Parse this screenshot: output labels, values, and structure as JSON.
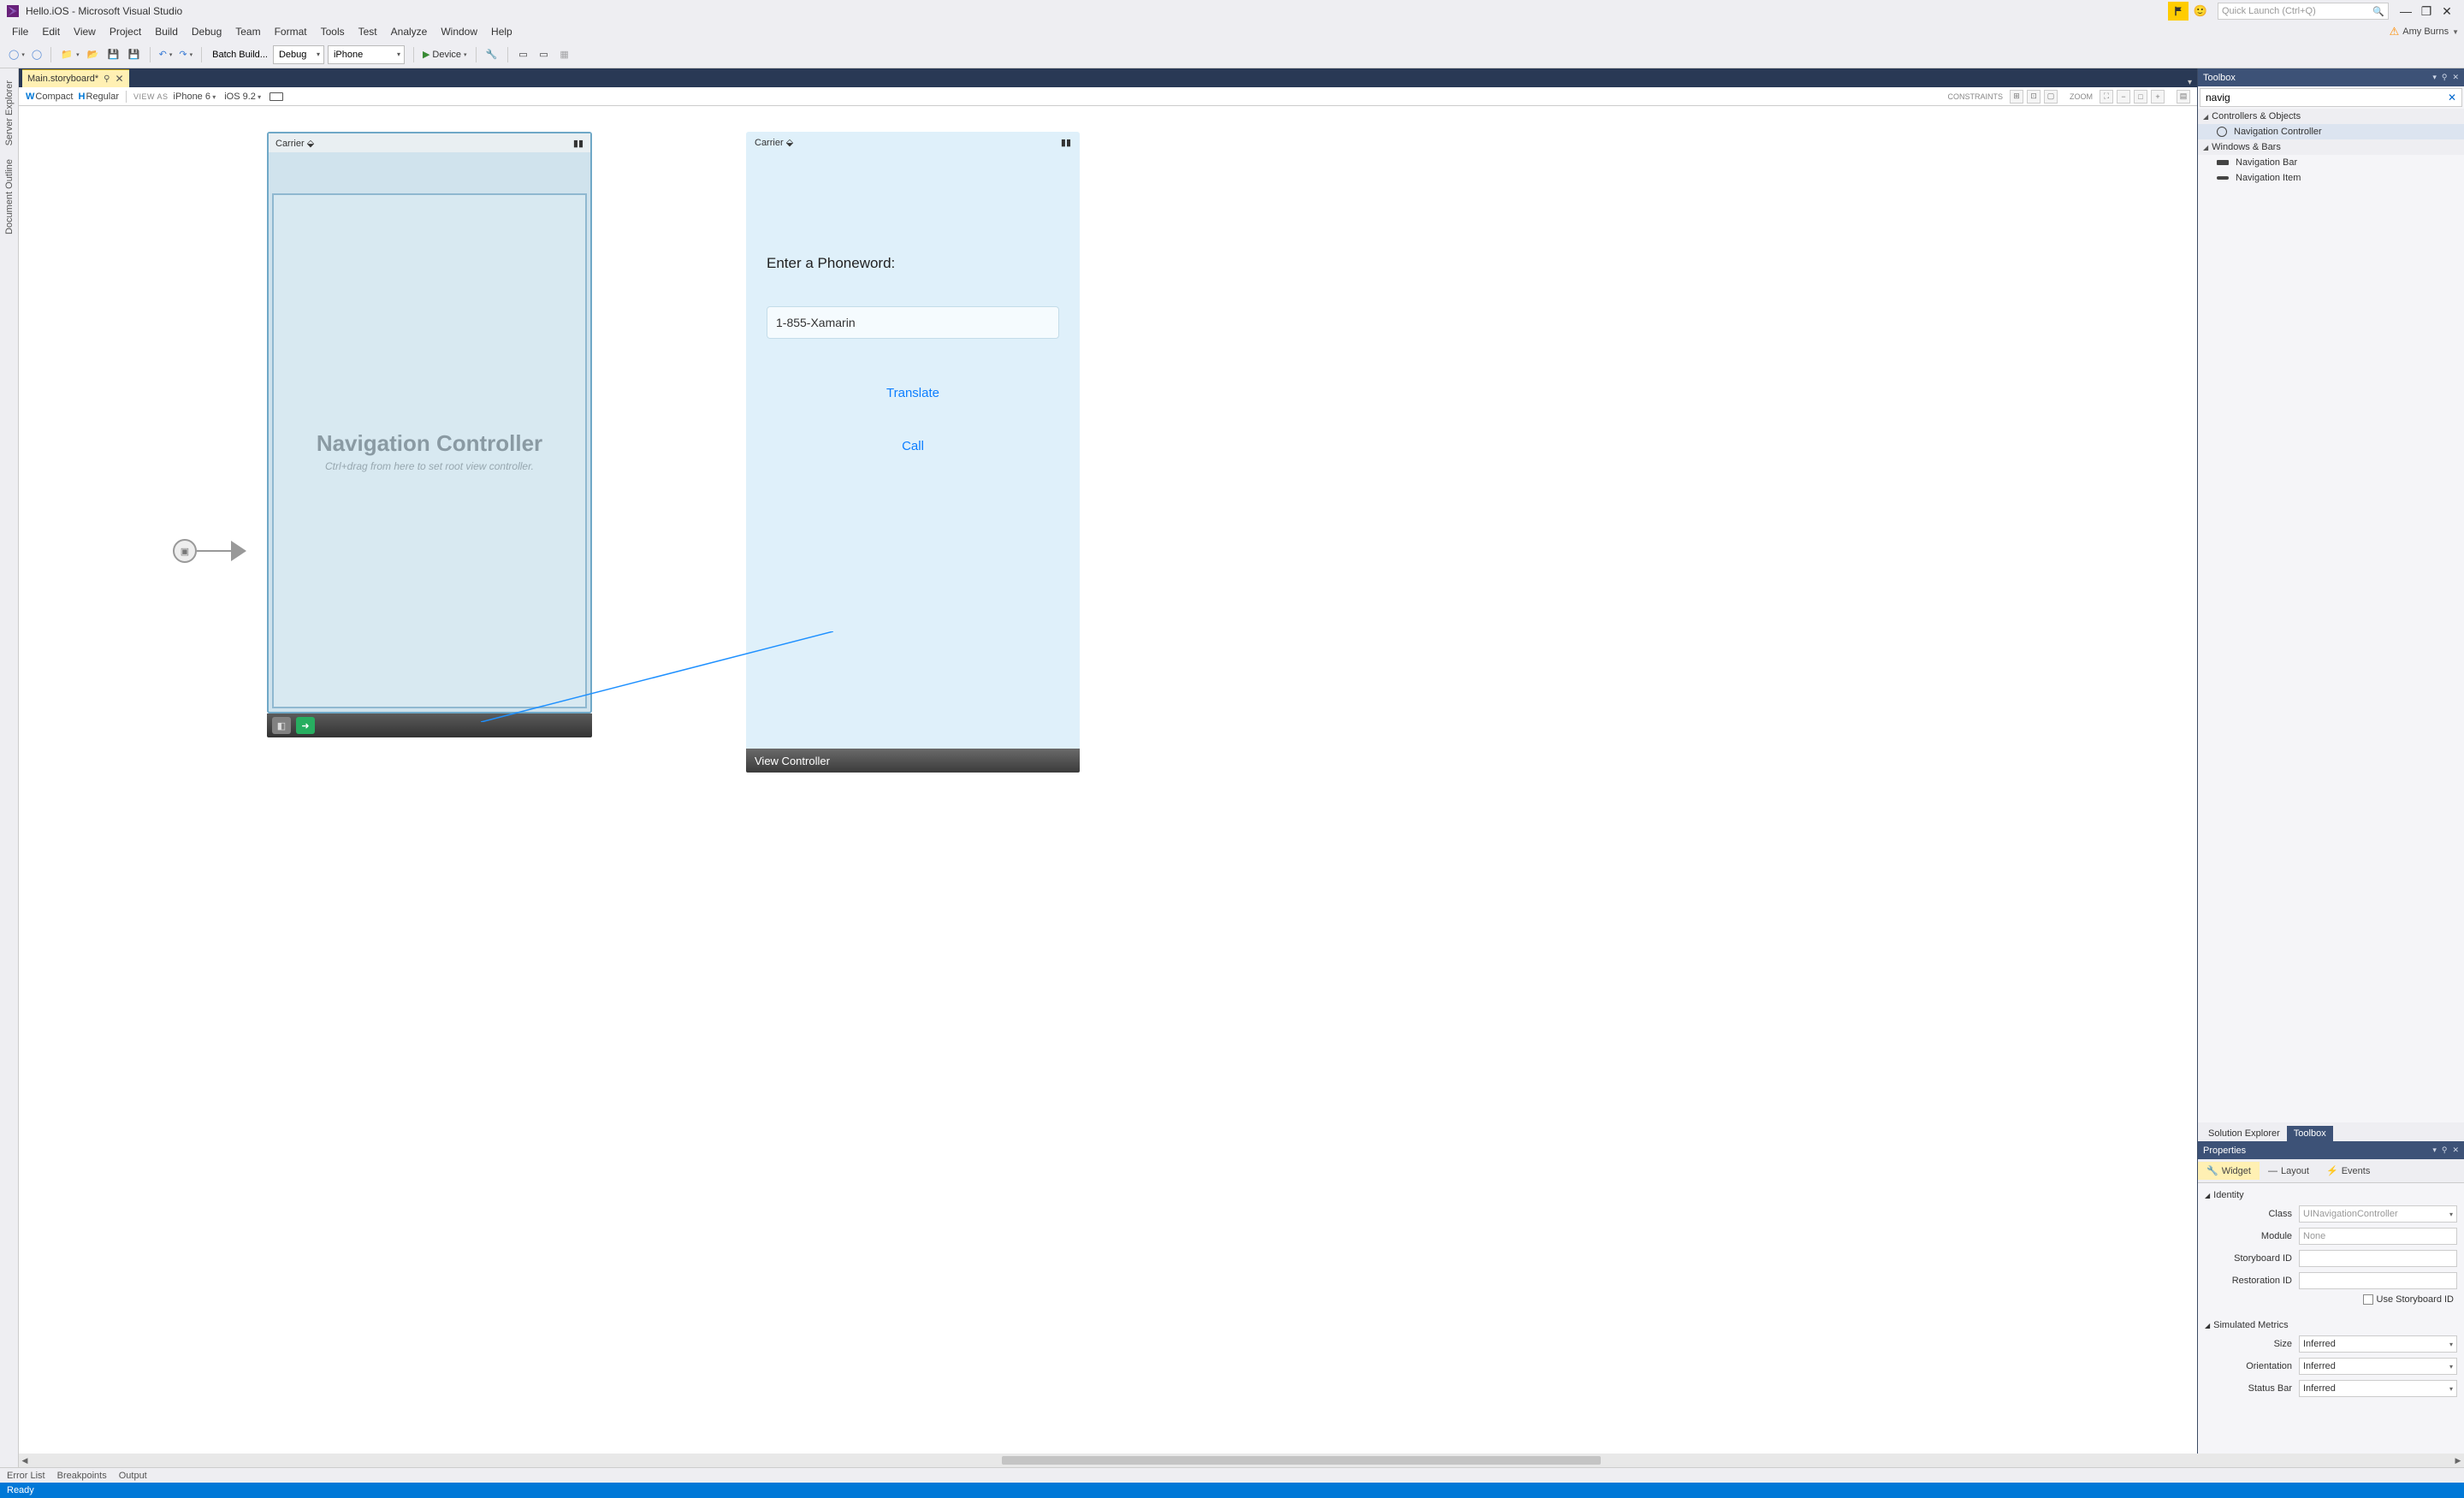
{
  "title": "Hello.iOS - Microsoft Visual Studio",
  "quickLaunch": {
    "placeholder": "Quick Launch (Ctrl+Q)"
  },
  "menu": [
    "File",
    "Edit",
    "View",
    "Project",
    "Build",
    "Debug",
    "Team",
    "Format",
    "Tools",
    "Test",
    "Analyze",
    "Window",
    "Help"
  ],
  "user": "Amy Burns",
  "toolbar": {
    "batchBuild": "Batch Build...",
    "config": "Debug",
    "platform": "iPhone",
    "device": "Device"
  },
  "leftRail": [
    "Server Explorer",
    "Document Outline"
  ],
  "docTab": "Main.storyboard*",
  "designerBar": {
    "wLetter": "W",
    "wVal": "Compact",
    "hLetter": "H",
    "hVal": "Regular",
    "viewAs": "VIEW AS",
    "device": "iPhone 6",
    "os": "iOS 9.2",
    "constraints": "CONSTRAINTS",
    "zoom": "ZOOM"
  },
  "phone1": {
    "carrier": "Carrier",
    "title": "Navigation Controller",
    "sub": "Ctrl+drag from here to set root view controller."
  },
  "phone2": {
    "carrier": "Carrier",
    "label": "Enter a Phoneword:",
    "textValue": "1-855-Xamarin",
    "translate": "Translate",
    "call": "Call",
    "bottom": "View Controller"
  },
  "toolboxPane": {
    "title": "Toolbox",
    "search": "navig",
    "groups": [
      {
        "name": "Controllers & Objects",
        "items": [
          {
            "icon": "nc",
            "label": "Navigation Controller",
            "selected": true
          }
        ]
      },
      {
        "name": "Windows & Bars",
        "items": [
          {
            "icon": "bar",
            "label": "Navigation Bar"
          },
          {
            "icon": "navitem",
            "label": "Navigation Item"
          }
        ]
      }
    ]
  },
  "paneTabs": {
    "solution": "Solution Explorer",
    "toolbox": "Toolbox"
  },
  "propertiesPane": {
    "title": "Properties",
    "tabs": {
      "widget": "Widget",
      "layout": "Layout",
      "events": "Events"
    },
    "identity": {
      "header": "Identity",
      "classLabel": "Class",
      "classValue": "UINavigationController",
      "moduleLabel": "Module",
      "moduleValue": "None",
      "storyboardIdLabel": "Storyboard ID",
      "restorationIdLabel": "Restoration ID",
      "useSb": "Use Storyboard ID"
    },
    "simMetrics": {
      "header": "Simulated Metrics",
      "sizeLabel": "Size",
      "sizeValue": "Inferred",
      "orientLabel": "Orientation",
      "orientValue": "Inferred",
      "statusLabel": "Status Bar",
      "statusValue": "Inferred"
    }
  },
  "bottomTabs": [
    "Error List",
    "Breakpoints",
    "Output"
  ],
  "status": "Ready"
}
